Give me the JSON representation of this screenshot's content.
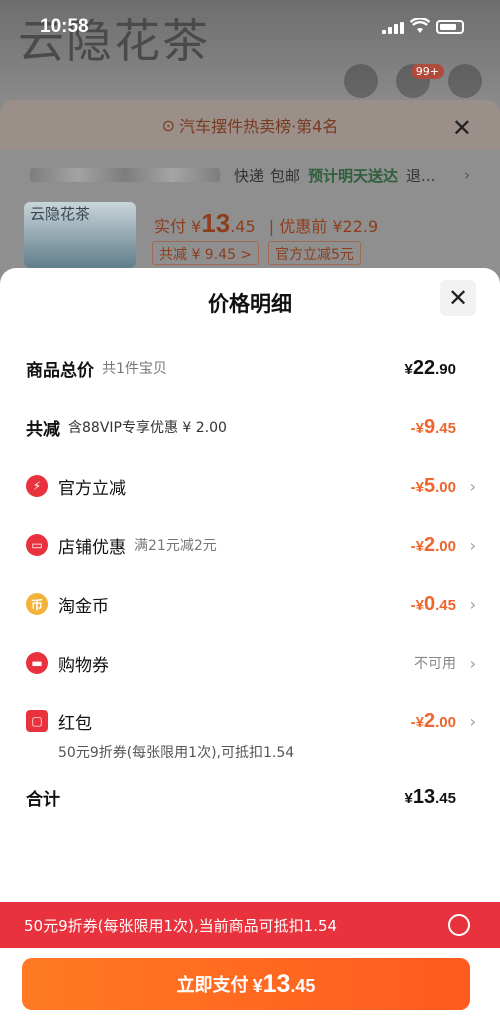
{
  "status_bar": {
    "time": "10:58"
  },
  "background": {
    "brand_text": "云隐花茶",
    "cart_badge": "99+",
    "rank_text": "汽车摆件热卖榜·第4名",
    "shipping": {
      "express": "快递",
      "free": "包邮",
      "eta": "预计明天送达",
      "return": "退..."
    },
    "product_brand": "云隐花茶",
    "real_price_label": "实付",
    "real_price_currency": "¥",
    "real_price_int": "13",
    "real_price_dec": ".45",
    "before_label": "优惠前",
    "before_price": "¥22.9",
    "chip_total": "共减 ¥ 9.45 >",
    "chip_official": "官方立减5元"
  },
  "sheet": {
    "title": "价格明细",
    "rows": [
      {
        "label": "商品总价",
        "sub": "共1件宝贝",
        "currency": "¥",
        "int": "22",
        "dec": ".90"
      },
      {
        "label": "共减",
        "sub": "含88VIP专享优惠 ¥ 2.00",
        "currency": "-¥",
        "int": "9",
        "dec": ".45"
      },
      {
        "label": "官方立减",
        "icon": "lightning-icon",
        "currency": "-¥",
        "int": "5",
        "dec": ".00"
      },
      {
        "label": "店铺优惠",
        "sub": "满21元减2元",
        "icon": "shop-icon",
        "currency": "-¥",
        "int": "2",
        "dec": ".00"
      },
      {
        "label": "淘金币",
        "icon": "coin-icon",
        "currency": "-¥",
        "int": "0",
        "dec": ".45"
      },
      {
        "label": "购物券",
        "icon": "ticket-icon",
        "status": "不可用"
      },
      {
        "label": "红包",
        "icon": "red-envelope-icon",
        "currency": "-¥",
        "int": "2",
        "dec": ".00"
      }
    ],
    "redpacket_note": "50元9折券(每张限用1次),可抵扣1.54",
    "total": {
      "label": "合计",
      "currency": "¥",
      "int": "13",
      "dec": ".45"
    }
  },
  "coupon_bar": {
    "text": "50元9折券(每张限用1次),当前商品可抵扣1.54"
  },
  "pay_button": {
    "label": "立即支付",
    "currency": "¥",
    "int": "13",
    "dec": ".45"
  },
  "colors": {
    "accent_orange": "#f0652b",
    "coupon_red": "#e8323d",
    "pay_orange": "#ff6a20"
  }
}
